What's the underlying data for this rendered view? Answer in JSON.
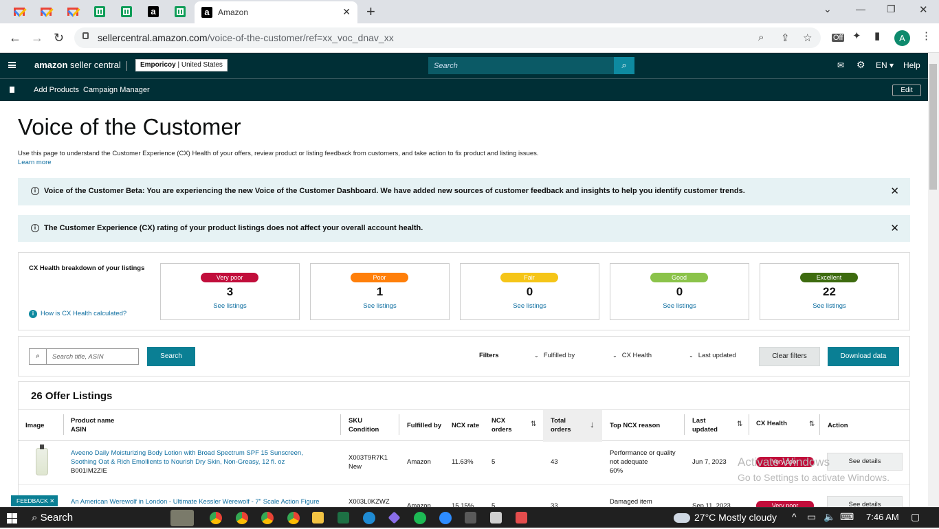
{
  "browser": {
    "active_tab_title": "Amazon",
    "url_domain": "sellercentral.amazon.com",
    "url_path": "/voice-of-the-customer/ref=xx_voc_dnav_xx",
    "profile_initial": "A",
    "ext_badge": "Off"
  },
  "header": {
    "logo_text": "amazon",
    "logo_suffix": "seller central",
    "account_name": "Emporicoy",
    "account_region": "United States",
    "search_placeholder": "Search",
    "language": "EN",
    "help": "Help",
    "nav_links": [
      "Add Products",
      "Campaign Manager"
    ],
    "edit_label": "Edit"
  },
  "page": {
    "title": "Voice of the Customer",
    "description": "Use this page to understand the Customer Experience (CX) Health of your offers, review product or listing feedback from customers, and take action to fix product and listing issues.",
    "learn_more": "Learn more",
    "banner1": "Voice of the Customer Beta: You are experiencing the new Voice of the Customer Dashboard. We have added new sources of customer feedback and insights to help you identify customer trends.",
    "banner2": "The Customer Experience (CX) rating of your product listings does not affect your overall account health."
  },
  "cx_health": {
    "label": "CX Health breakdown of your listings",
    "how_link": "How is CX Health calculated?",
    "see_listings": "See listings",
    "cards": [
      {
        "label": "Very poor",
        "count": "3",
        "color": "#c10e3b"
      },
      {
        "label": "Poor",
        "count": "1",
        "color": "#ff7f0a"
      },
      {
        "label": "Fair",
        "count": "0",
        "color": "#f5c518"
      },
      {
        "label": "Good",
        "count": "0",
        "color": "#8bc34a"
      },
      {
        "label": "Excellent",
        "count": "22",
        "color": "#3d6b0f"
      }
    ]
  },
  "filters": {
    "search_placeholder": "Search title, ASIN",
    "search_button": "Search",
    "filters_label": "Filters",
    "fulfilled_by": "Fulfilled by",
    "cx_health": "CX Health",
    "last_updated": "Last updated",
    "clear_filters": "Clear filters",
    "download": "Download data"
  },
  "listings": {
    "title": "26 Offer Listings",
    "columns": {
      "image": "Image",
      "product_name": "Product name",
      "asin": "ASIN",
      "sku": "SKU",
      "condition": "Condition",
      "fulfilled_by": "Fulfilled by",
      "ncx_rate": "NCX rate",
      "ncx_orders_1": "NCX",
      "ncx_orders_2": "orders",
      "total_orders_1": "Total",
      "total_orders_2": "orders",
      "top_reason": "Top NCX reason",
      "last_updated_1": "Last",
      "last_updated_2": "updated",
      "cx_health": "CX Health",
      "action": "Action"
    },
    "rows": [
      {
        "name_line1": "Aveeno Daily Moisturizing Body Lotion with Broad Spectrum SPF 15 Sunscreen,",
        "name_line2": "Soothing Oat & Rich Emollients to Nourish Dry Skin, Non-Greasy, 12 fl. oz",
        "asin": "B001IM2ZIE",
        "sku": "X003T9R7K1",
        "condition": "New",
        "fulfilled_by": "Amazon",
        "ncx_rate": "11.63%",
        "ncx_orders": "5",
        "total_orders": "43",
        "reason_line1": "Performance or quality",
        "reason_line2": "not adequate",
        "reason_pct": "60%",
        "last_updated": "Jun 7, 2023",
        "cx_health": "Very poor",
        "action": "See details"
      },
      {
        "name_line1": "An American Werewolf in London - Ultimate Kessler Werewolf - 7\" Scale Action Figure",
        "sku": "X003L0KZWZ",
        "fulfilled_by": "Amazon",
        "ncx_rate": "15.15%",
        "ncx_orders": "5",
        "total_orders": "33",
        "reason_line1": "Damaged item",
        "last_updated": "Sep 11, 2023",
        "cx_health": "Very poor",
        "action": "See details"
      }
    ]
  },
  "overlay": {
    "watermark_line1": "Activate Windows",
    "watermark_line2": "Go to Settings to activate Windows.",
    "feedback": "FEEDBACK"
  },
  "taskbar": {
    "search": "Search",
    "weather": "27°C  Mostly cloudy",
    "time": "7:46 AM"
  }
}
